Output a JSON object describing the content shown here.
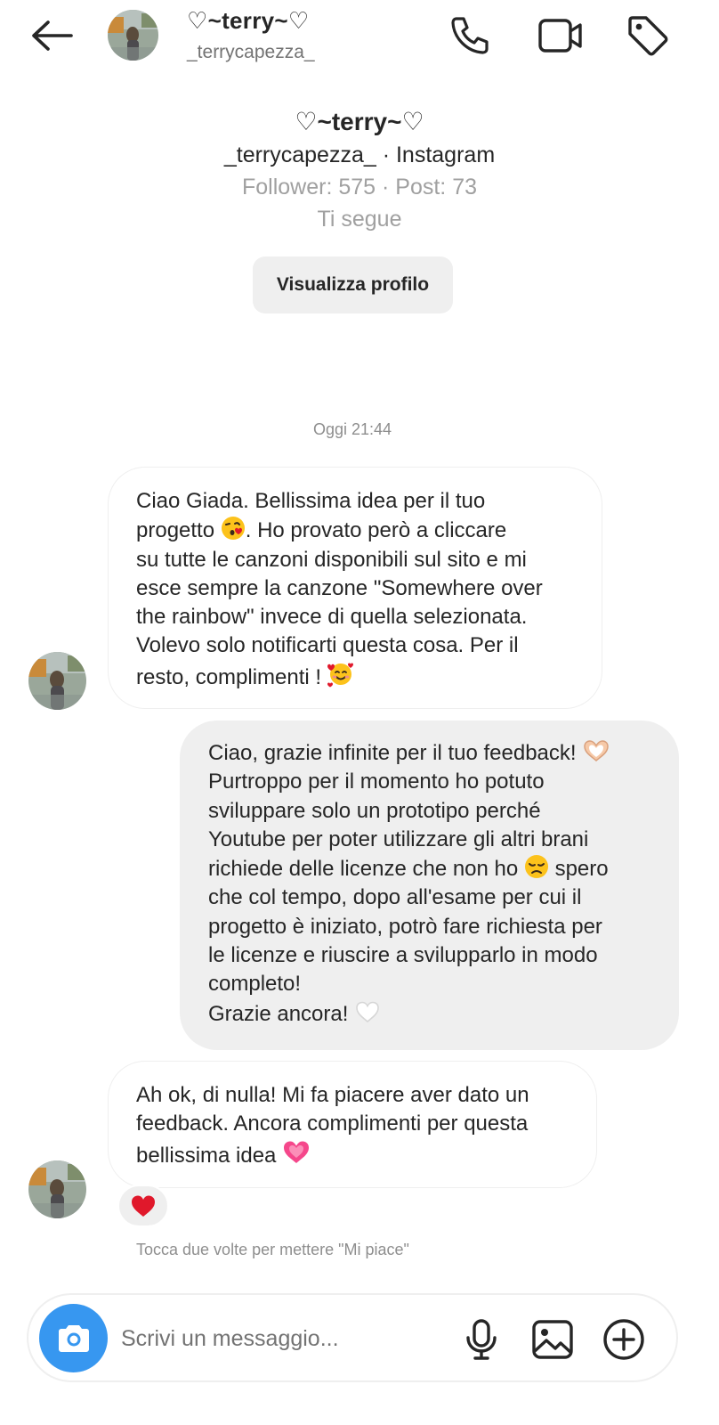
{
  "header": {
    "name": "♡~terry~♡",
    "username": "_terrycapezza_",
    "icons": [
      "back-arrow-icon",
      "avatar",
      "phone-icon",
      "video-camera-icon",
      "tag-icon"
    ]
  },
  "profile": {
    "name": "♡~terry~♡",
    "subtitle": "_terrycapezza_ · Instagram",
    "stats": "Follower: 575 · Post: 73",
    "follow_status": "Ti segue",
    "view_profile_label": "Visualizza profilo"
  },
  "thread": {
    "timestamp": "Oggi 21:44",
    "messages": [
      {
        "from": "them",
        "text_a": "Ciao Giada. Bellissima idea per il tuo\nprogetto ",
        "text_b": ". Ho provato però a cliccare\nsu tutte le canzoni disponibili sul sito e mi\nesce sempre la canzone \"Somewhere over\nthe rainbow\"  invece di quella selezionata.\nVolevo solo notificarti questa cosa. Per il\nresto, complimenti ! "
      },
      {
        "from": "me",
        "text_a": "Ciao, grazie infinite per il tuo feedback! ",
        "text_b": "\nPurtroppo per il momento ho potuto\nsviluppare solo un prototipo perché\nYoutube per poter utilizzare gli altri brani\nrichiede delle licenze che non ho ",
        "text_c": "  spero\nche col tempo, dopo all'esame per cui il\nprogetto è iniziato, potrò fare richiesta per\nle licenze e riuscire a svilupparlo in modo\ncompleto!\nGrazie ancora! "
      },
      {
        "from": "them",
        "text_a": "Ah ok, di nulla! Mi fa piacere aver dato un\nfeedback. Ancora complimenti per questa\nbellissima idea ",
        "reaction": "heart-icon"
      }
    ],
    "like_hint": "Tocca due volte per mettere \"Mi piace\""
  },
  "composer": {
    "placeholder": "Scrivi un messaggio...",
    "icons": [
      "camera-icon",
      "microphone-icon",
      "gallery-icon",
      "plus-circle-icon"
    ]
  },
  "colors": {
    "accent_blue": "#3797f0",
    "bubble_grey": "#efefef",
    "text": "#262626",
    "muted": "#8e8e8e",
    "heart_red": "#e0182b"
  }
}
